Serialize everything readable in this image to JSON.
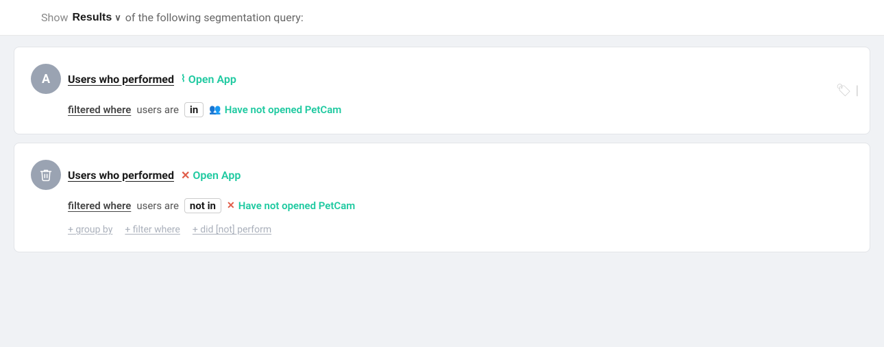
{
  "header": {
    "show_label": "Show",
    "results_button": "Results",
    "chevron": "∨",
    "query_text": "of the following segmentation query:"
  },
  "blocks": [
    {
      "id": "block-a",
      "badge_type": "letter",
      "badge_label": "A",
      "users_who_performed": "Users who performed",
      "event_icon_type": "activity",
      "event_name": "Open App",
      "filtered_where": "filtered where",
      "users_are": "users are",
      "operator": "in",
      "cohort_icon_type": "users",
      "cohort_name": "Have not opened PetCam",
      "has_add_row": false
    },
    {
      "id": "block-b",
      "badge_type": "trash",
      "badge_label": "🗑",
      "users_who_performed": "Users who performed",
      "event_icon_type": "x",
      "event_name": "Open App",
      "filtered_where": "filtered where",
      "users_are": "users are",
      "operator": "not in",
      "cohort_icon_type": "x",
      "cohort_name": "Have not opened PetCam",
      "has_add_row": true,
      "add_links": [
        "+ group by",
        "+ filter where",
        "+ did [not] perform"
      ]
    }
  ],
  "tag_icon_label": "🏷",
  "pipe_label": "|"
}
